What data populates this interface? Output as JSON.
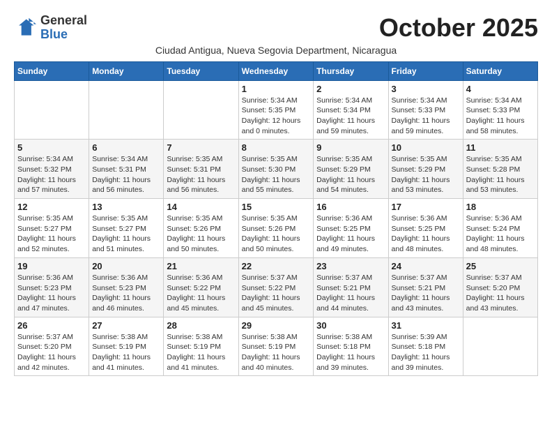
{
  "logo": {
    "general": "General",
    "blue": "Blue"
  },
  "header": {
    "month_title": "October 2025",
    "subtitle": "Ciudad Antigua, Nueva Segovia Department, Nicaragua"
  },
  "days_of_week": [
    "Sunday",
    "Monday",
    "Tuesday",
    "Wednesday",
    "Thursday",
    "Friday",
    "Saturday"
  ],
  "weeks": [
    [
      {
        "day": "",
        "info": ""
      },
      {
        "day": "",
        "info": ""
      },
      {
        "day": "",
        "info": ""
      },
      {
        "day": "1",
        "info": "Sunrise: 5:34 AM\nSunset: 5:35 PM\nDaylight: 12 hours\nand 0 minutes."
      },
      {
        "day": "2",
        "info": "Sunrise: 5:34 AM\nSunset: 5:34 PM\nDaylight: 11 hours\nand 59 minutes."
      },
      {
        "day": "3",
        "info": "Sunrise: 5:34 AM\nSunset: 5:33 PM\nDaylight: 11 hours\nand 59 minutes."
      },
      {
        "day": "4",
        "info": "Sunrise: 5:34 AM\nSunset: 5:33 PM\nDaylight: 11 hours\nand 58 minutes."
      }
    ],
    [
      {
        "day": "5",
        "info": "Sunrise: 5:34 AM\nSunset: 5:32 PM\nDaylight: 11 hours\nand 57 minutes."
      },
      {
        "day": "6",
        "info": "Sunrise: 5:34 AM\nSunset: 5:31 PM\nDaylight: 11 hours\nand 56 minutes."
      },
      {
        "day": "7",
        "info": "Sunrise: 5:35 AM\nSunset: 5:31 PM\nDaylight: 11 hours\nand 56 minutes."
      },
      {
        "day": "8",
        "info": "Sunrise: 5:35 AM\nSunset: 5:30 PM\nDaylight: 11 hours\nand 55 minutes."
      },
      {
        "day": "9",
        "info": "Sunrise: 5:35 AM\nSunset: 5:29 PM\nDaylight: 11 hours\nand 54 minutes."
      },
      {
        "day": "10",
        "info": "Sunrise: 5:35 AM\nSunset: 5:29 PM\nDaylight: 11 hours\nand 53 minutes."
      },
      {
        "day": "11",
        "info": "Sunrise: 5:35 AM\nSunset: 5:28 PM\nDaylight: 11 hours\nand 53 minutes."
      }
    ],
    [
      {
        "day": "12",
        "info": "Sunrise: 5:35 AM\nSunset: 5:27 PM\nDaylight: 11 hours\nand 52 minutes."
      },
      {
        "day": "13",
        "info": "Sunrise: 5:35 AM\nSunset: 5:27 PM\nDaylight: 11 hours\nand 51 minutes."
      },
      {
        "day": "14",
        "info": "Sunrise: 5:35 AM\nSunset: 5:26 PM\nDaylight: 11 hours\nand 50 minutes."
      },
      {
        "day": "15",
        "info": "Sunrise: 5:35 AM\nSunset: 5:26 PM\nDaylight: 11 hours\nand 50 minutes."
      },
      {
        "day": "16",
        "info": "Sunrise: 5:36 AM\nSunset: 5:25 PM\nDaylight: 11 hours\nand 49 minutes."
      },
      {
        "day": "17",
        "info": "Sunrise: 5:36 AM\nSunset: 5:25 PM\nDaylight: 11 hours\nand 48 minutes."
      },
      {
        "day": "18",
        "info": "Sunrise: 5:36 AM\nSunset: 5:24 PM\nDaylight: 11 hours\nand 48 minutes."
      }
    ],
    [
      {
        "day": "19",
        "info": "Sunrise: 5:36 AM\nSunset: 5:23 PM\nDaylight: 11 hours\nand 47 minutes."
      },
      {
        "day": "20",
        "info": "Sunrise: 5:36 AM\nSunset: 5:23 PM\nDaylight: 11 hours\nand 46 minutes."
      },
      {
        "day": "21",
        "info": "Sunrise: 5:36 AM\nSunset: 5:22 PM\nDaylight: 11 hours\nand 45 minutes."
      },
      {
        "day": "22",
        "info": "Sunrise: 5:37 AM\nSunset: 5:22 PM\nDaylight: 11 hours\nand 45 minutes."
      },
      {
        "day": "23",
        "info": "Sunrise: 5:37 AM\nSunset: 5:21 PM\nDaylight: 11 hours\nand 44 minutes."
      },
      {
        "day": "24",
        "info": "Sunrise: 5:37 AM\nSunset: 5:21 PM\nDaylight: 11 hours\nand 43 minutes."
      },
      {
        "day": "25",
        "info": "Sunrise: 5:37 AM\nSunset: 5:20 PM\nDaylight: 11 hours\nand 43 minutes."
      }
    ],
    [
      {
        "day": "26",
        "info": "Sunrise: 5:37 AM\nSunset: 5:20 PM\nDaylight: 11 hours\nand 42 minutes."
      },
      {
        "day": "27",
        "info": "Sunrise: 5:38 AM\nSunset: 5:19 PM\nDaylight: 11 hours\nand 41 minutes."
      },
      {
        "day": "28",
        "info": "Sunrise: 5:38 AM\nSunset: 5:19 PM\nDaylight: 11 hours\nand 41 minutes."
      },
      {
        "day": "29",
        "info": "Sunrise: 5:38 AM\nSunset: 5:19 PM\nDaylight: 11 hours\nand 40 minutes."
      },
      {
        "day": "30",
        "info": "Sunrise: 5:38 AM\nSunset: 5:18 PM\nDaylight: 11 hours\nand 39 minutes."
      },
      {
        "day": "31",
        "info": "Sunrise: 5:39 AM\nSunset: 5:18 PM\nDaylight: 11 hours\nand 39 minutes."
      },
      {
        "day": "",
        "info": ""
      }
    ]
  ]
}
